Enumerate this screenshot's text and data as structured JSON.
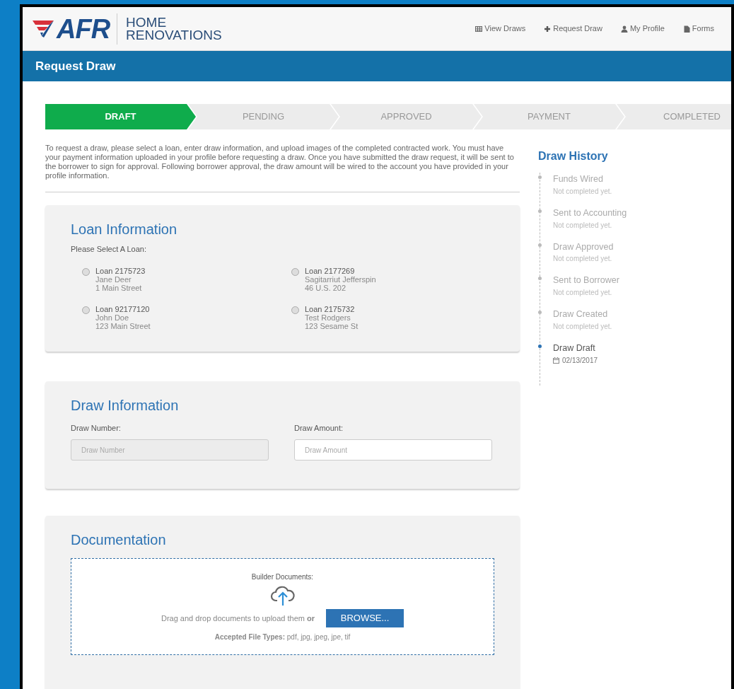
{
  "header": {
    "logo": {
      "wordmark": "AFR",
      "line_1": "HOME",
      "line_2": "RENOVATIONS"
    },
    "nav": [
      {
        "label": "View Draws"
      },
      {
        "label": "Request Draw"
      },
      {
        "label": "My Profile"
      },
      {
        "label": "Forms"
      }
    ]
  },
  "page_title": "Request Draw",
  "steps": [
    {
      "label": "DRAFT",
      "selected": true
    },
    {
      "label": "PENDING",
      "selected": false
    },
    {
      "label": "APPROVED",
      "selected": false
    },
    {
      "label": "PAYMENT",
      "selected": false
    },
    {
      "label": "COMPLETED",
      "selected": false
    }
  ],
  "intro": "To request a draw, please select a loan, enter draw information, and upload images of the completed contracted work. You must have your payment information uploaded in your profile before requesting a draw. Once you have submitted the draw request, it will be sent to the borrower to sign for approval. Following borrower approval, the draw amount will be wired to the account you have provided in your profile information.",
  "loan_information": {
    "title": "Loan Information",
    "prompt": "Please Select A Loan:",
    "loans": [
      {
        "number": "Loan 2175723",
        "name": "Jane Deer",
        "address": "1 Main Street",
        "checked": false
      },
      {
        "number": "Loan 2177269",
        "name": "Sagitarriut Jefferspin",
        "address": "46 U.S. 202",
        "checked": false
      },
      {
        "number": "Loan 92177120",
        "name": "John Doe",
        "address": "123 Main Street",
        "checked": false
      },
      {
        "number": "Loan 2175732",
        "name": "Test Rodgers",
        "address": "123 Sesame St",
        "checked": false
      }
    ]
  },
  "draw_information": {
    "title": "Draw Information",
    "fields": [
      {
        "label": "Draw Number:",
        "placeholder": "Draw Number",
        "disabled": true
      },
      {
        "label": "Draw Amount:",
        "placeholder": "Draw Amount",
        "disabled": false
      }
    ]
  },
  "documentation": {
    "title": "Documentation",
    "upload_label": "Builder Documents:",
    "drop_text": "Drag and drop documents to upload them **or**",
    "button": "BROWSE...",
    "accepted": "**Accepted File Types:** pdf, jpg, jpeg, jpe, tif"
  },
  "draw_history": {
    "title": "Draw History",
    "events": [
      {
        "title": "Funds Wired",
        "detail": "Not completed yet.",
        "completed": false
      },
      {
        "title": "Sent to Accounting",
        "detail": "Not completed yet.",
        "completed": false
      },
      {
        "title": "Draw Approved",
        "detail": "Not completed yet.",
        "completed": false
      },
      {
        "title": "Sent to Borrower",
        "detail": "Not completed yet.",
        "completed": false
      },
      {
        "title": "Draw Created",
        "detail": "Not completed yet.",
        "completed": false
      },
      {
        "title": "Draw Draft",
        "detail": "02/13/2017",
        "completed": true
      }
    ]
  }
}
